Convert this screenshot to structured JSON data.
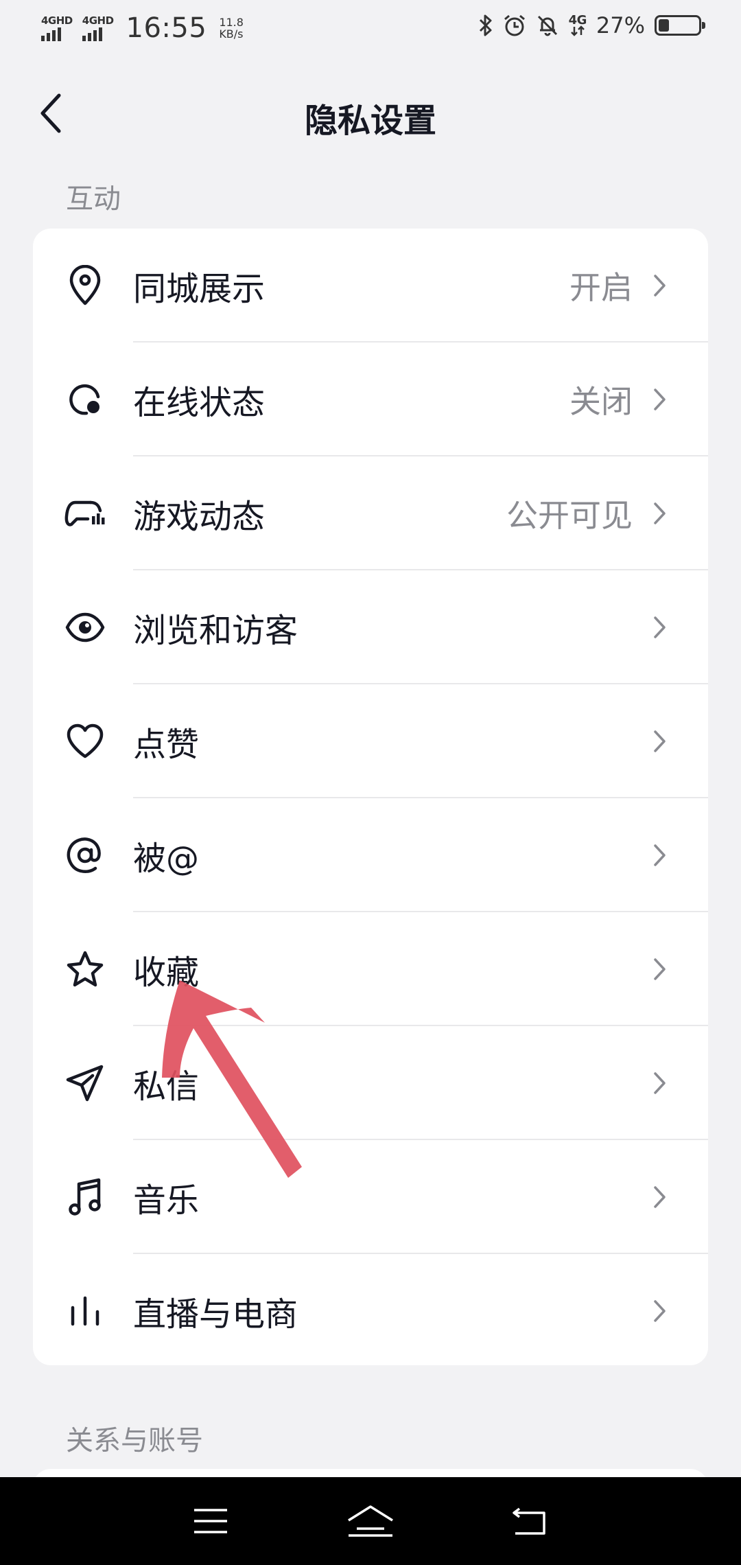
{
  "status_bar": {
    "net1": "4GHD",
    "net2": "4GHD",
    "time": "16:55",
    "speed_value": "11.8",
    "speed_unit": "KB/s",
    "net3": "4G",
    "battery_percent": "27%",
    "battery_level": 0.27
  },
  "header": {
    "title": "隐私设置",
    "back_icon": "chevron-left-icon"
  },
  "sections": [
    {
      "label": "互动",
      "items": [
        {
          "icon": "location-pin-icon",
          "label": "同城展示",
          "value": "开启"
        },
        {
          "icon": "online-status-icon",
          "label": "在线状态",
          "value": "关闭"
        },
        {
          "icon": "gamepad-icon",
          "label": "游戏动态",
          "value": "公开可见"
        },
        {
          "icon": "eye-icon",
          "label": "浏览和访客",
          "value": ""
        },
        {
          "icon": "heart-icon",
          "label": "点赞",
          "value": ""
        },
        {
          "icon": "at-icon",
          "label": "被@",
          "value": ""
        },
        {
          "icon": "star-icon",
          "label": "收藏",
          "value": ""
        },
        {
          "icon": "paper-plane-icon",
          "label": "私信",
          "value": ""
        },
        {
          "icon": "music-note-icon",
          "label": "音乐",
          "value": ""
        },
        {
          "icon": "bars-icon",
          "label": "直播与电商",
          "value": ""
        }
      ]
    },
    {
      "label": "关系与账号"
    }
  ],
  "annotation": {
    "arrow_color": "#e0505e"
  },
  "nav_bar": {
    "menu_icon": "menu-icon",
    "home_icon": "home-icon",
    "back_icon": "back-icon"
  }
}
